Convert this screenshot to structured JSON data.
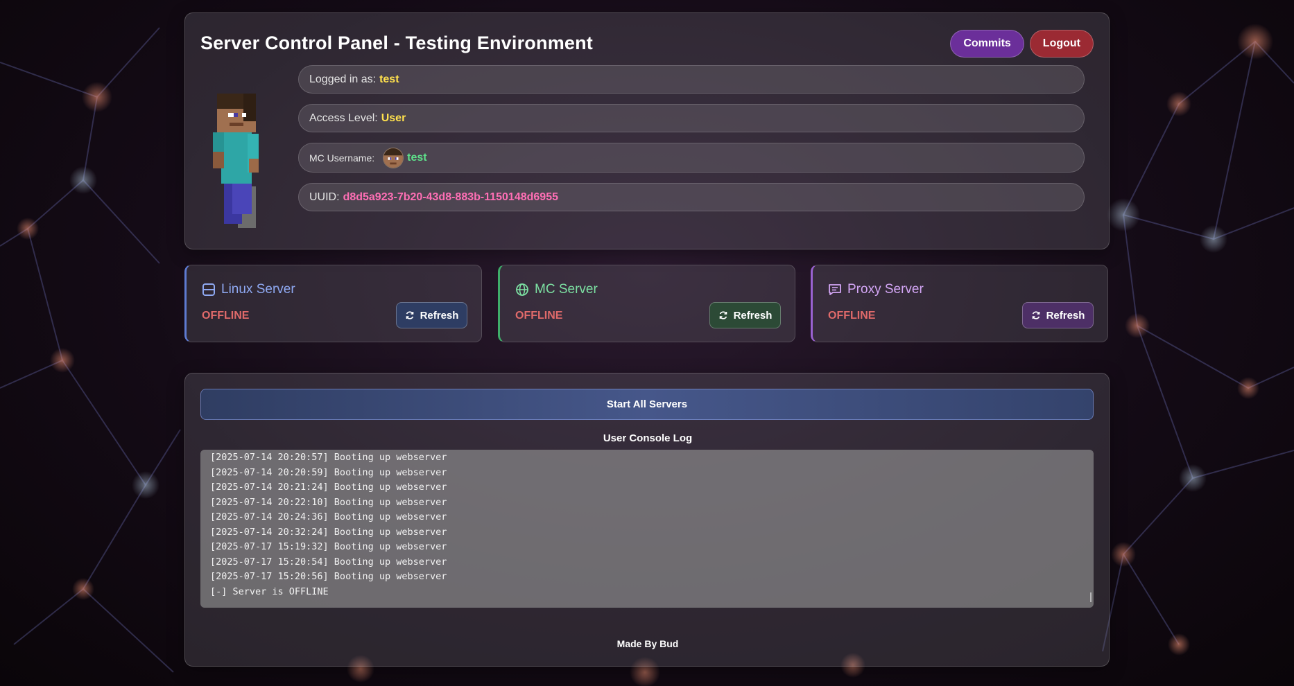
{
  "header": {
    "title": "Server Control Panel - Testing Environment",
    "commits_label": "Commits",
    "logout_label": "Logout"
  },
  "profile": {
    "logged_in_label": "Logged in as:",
    "logged_in_value": "test",
    "access_label": "Access Level:",
    "access_value": "User",
    "mc_label": "MC Username:",
    "mc_value": "test",
    "uuid_label": "UUID:",
    "uuid_value": "d8d5a923-7b20-43d8-883b-1150148d6955"
  },
  "servers": [
    {
      "name": "Linux Server",
      "icon": "server-icon",
      "status": "OFFLINE",
      "refresh_label": "Refresh",
      "accent": "#5e7bd1"
    },
    {
      "name": "MC Server",
      "icon": "globe-icon",
      "status": "OFFLINE",
      "refresh_label": "Refresh",
      "accent": "#3fae6a"
    },
    {
      "name": "Proxy Server",
      "icon": "message-icon",
      "status": "OFFLINE",
      "refresh_label": "Refresh",
      "accent": "#9a62d1"
    }
  ],
  "controls": {
    "start_all_label": "Start All Servers",
    "log_title": "User Console Log"
  },
  "console": {
    "lines": [
      "[2025-07-14 20:20:57] Booting up webserver",
      "[2025-07-14 20:20:59] Booting up webserver",
      "[2025-07-14 20:21:24] Booting up webserver",
      "[2025-07-14 20:22:10] Booting up webserver",
      "[2025-07-14 20:24:36] Booting up webserver",
      "[2025-07-14 20:32:24] Booting up webserver",
      "[2025-07-17 15:19:32] Booting up webserver",
      "[2025-07-17 15:20:54] Booting up webserver",
      "[2025-07-17 15:20:56] Booting up webserver",
      "[-] Server is OFFLINE"
    ]
  },
  "footer": {
    "text": "Made By Bud"
  },
  "colors": {
    "status_offline": "#e06a6a",
    "username": "#ffe14d",
    "access": "#ffe14d",
    "mc_username": "#5ee08a",
    "uuid": "#ff6fb5"
  }
}
